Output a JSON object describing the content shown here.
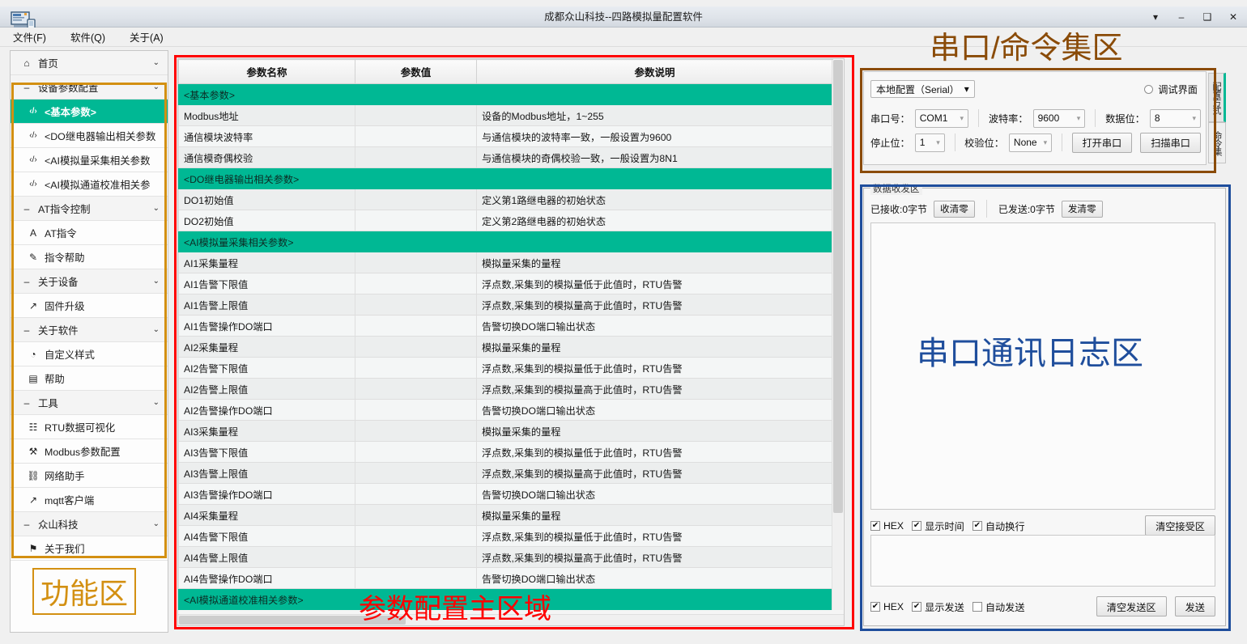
{
  "window": {
    "title": "成都众山科技--四路模拟量配置软件",
    "controls": [
      "▾",
      "–",
      "❑",
      "✕"
    ],
    "app_icon": "computer-icon"
  },
  "menubar": {
    "items": [
      "文件(F)",
      "软件(Q)",
      "关于(A)"
    ]
  },
  "sidebar": {
    "items": [
      {
        "label": "首页",
        "icon": "home-icon",
        "type": "group",
        "chevron": "⌄",
        "active": false
      },
      {
        "label": "设备参数配置",
        "icon": "minus-icon",
        "type": "group",
        "chevron": "⌄",
        "active": false
      },
      {
        "label": "<基本参数>",
        "icon": "code-icon",
        "type": "child",
        "active": true
      },
      {
        "label": "<DO继电器输出相关参数",
        "icon": "code-icon",
        "type": "child",
        "active": false
      },
      {
        "label": "<AI模拟量采集相关参数",
        "icon": "code-icon",
        "type": "child",
        "active": false
      },
      {
        "label": "<AI模拟通道校准相关参",
        "icon": "code-icon",
        "type": "child",
        "active": false
      },
      {
        "label": "AT指令控制",
        "icon": "minus-icon",
        "type": "group",
        "chevron": "⌄",
        "active": false
      },
      {
        "label": "AT指令",
        "icon": "letter-a-icon",
        "type": "child",
        "active": false
      },
      {
        "label": "指令帮助",
        "icon": "pen-icon",
        "type": "child",
        "active": false
      },
      {
        "label": "关于设备",
        "icon": "minus-icon",
        "type": "group",
        "chevron": "⌄",
        "active": false
      },
      {
        "label": "固件升级",
        "icon": "external-link-icon",
        "type": "child",
        "active": false
      },
      {
        "label": "关于软件",
        "icon": "minus-icon",
        "type": "group",
        "chevron": "⌄",
        "active": false
      },
      {
        "label": "自定义样式",
        "icon": "palette-icon",
        "type": "child",
        "active": false
      },
      {
        "label": "帮助",
        "icon": "book-icon",
        "type": "child",
        "active": false
      },
      {
        "label": "工具",
        "icon": "minus-icon",
        "type": "group",
        "chevron": "⌄",
        "active": false
      },
      {
        "label": "RTU数据可视化",
        "icon": "grid-icon",
        "type": "child",
        "active": false
      },
      {
        "label": "Modbus参数配置",
        "icon": "wrench-icon",
        "type": "child",
        "active": false
      },
      {
        "label": "网络助手",
        "icon": "network-icon",
        "type": "child",
        "active": false
      },
      {
        "label": "mqtt客户端",
        "icon": "external-link-icon",
        "type": "child",
        "active": false
      },
      {
        "label": "众山科技",
        "icon": "minus-icon",
        "type": "group",
        "chevron": "⌄",
        "active": false
      },
      {
        "label": "关于我们",
        "icon": "flag-icon",
        "type": "child",
        "active": false
      }
    ]
  },
  "table": {
    "headers": [
      "参数名称",
      "参数值",
      "参数说明"
    ],
    "rows": [
      {
        "section": true,
        "name": "<基本参数>",
        "value": "",
        "desc": ""
      },
      {
        "section": false,
        "name": "Modbus地址",
        "value": "",
        "desc": "设备的Modbus地址，1~255"
      },
      {
        "section": false,
        "name": "通信模块波特率",
        "value": "",
        "desc": "与通信模块的波特率一致，一般设置为9600"
      },
      {
        "section": false,
        "name": "通信模奇偶校验",
        "value": "",
        "desc": "与通信模块的奇偶校验一致，一般设置为8N1"
      },
      {
        "section": true,
        "name": "<DO继电器输出相关参数>",
        "value": "",
        "desc": ""
      },
      {
        "section": false,
        "name": "DO1初始值",
        "value": "",
        "desc": "定义第1路继电器的初始状态"
      },
      {
        "section": false,
        "name": "DO2初始值",
        "value": "",
        "desc": "定义第2路继电器的初始状态"
      },
      {
        "section": true,
        "name": "<AI模拟量采集相关参数>",
        "value": "",
        "desc": ""
      },
      {
        "section": false,
        "name": "AI1采集量程",
        "value": "",
        "desc": "模拟量采集的量程"
      },
      {
        "section": false,
        "name": "AI1告警下限值",
        "value": "",
        "desc": "浮点数,采集到的模拟量低于此值时，RTU告警"
      },
      {
        "section": false,
        "name": "AI1告警上限值",
        "value": "",
        "desc": "浮点数,采集到的模拟量高于此值时，RTU告警"
      },
      {
        "section": false,
        "name": "AI1告警操作DO端口",
        "value": "",
        "desc": "告警切换DO端口输出状态"
      },
      {
        "section": false,
        "name": "AI2采集量程",
        "value": "",
        "desc": "模拟量采集的量程"
      },
      {
        "section": false,
        "name": "AI2告警下限值",
        "value": "",
        "desc": "浮点数,采集到的模拟量低于此值时，RTU告警"
      },
      {
        "section": false,
        "name": "AI2告警上限值",
        "value": "",
        "desc": "浮点数,采集到的模拟量高于此值时，RTU告警"
      },
      {
        "section": false,
        "name": "AI2告警操作DO端口",
        "value": "",
        "desc": "告警切换DO端口输出状态"
      },
      {
        "section": false,
        "name": "AI3采集量程",
        "value": "",
        "desc": "模拟量采集的量程"
      },
      {
        "section": false,
        "name": "AI3告警下限值",
        "value": "",
        "desc": "浮点数,采集到的模拟量低于此值时，RTU告警"
      },
      {
        "section": false,
        "name": "AI3告警上限值",
        "value": "",
        "desc": "浮点数,采集到的模拟量高于此值时，RTU告警"
      },
      {
        "section": false,
        "name": "AI3告警操作DO端口",
        "value": "",
        "desc": "告警切换DO端口输出状态"
      },
      {
        "section": false,
        "name": "AI4采集量程",
        "value": "",
        "desc": "模拟量采集的量程"
      },
      {
        "section": false,
        "name": "AI4告警下限值",
        "value": "",
        "desc": "浮点数,采集到的模拟量低于此值时，RTU告警"
      },
      {
        "section": false,
        "name": "AI4告警上限值",
        "value": "",
        "desc": "浮点数,采集到的模拟量高于此值时，RTU告警"
      },
      {
        "section": false,
        "name": "AI4告警操作DO端口",
        "value": "",
        "desc": "告警切换DO端口输出状态"
      },
      {
        "section": true,
        "name": "<AI模拟通道校准相关参数>",
        "value": "",
        "desc": ""
      }
    ]
  },
  "serial": {
    "mode": "本地配置（Serial）",
    "mode_caret": "▾",
    "debug_label": "调试界面",
    "fields": {
      "port_label": "串口号：",
      "port_value": "COM1",
      "baud_label": "波特率：",
      "baud_value": "9600",
      "data_label": "数据位：",
      "data_value": "8",
      "stop_label": "停止位：",
      "stop_value": "1",
      "parity_label": "校验位：",
      "parity_value": "None"
    },
    "open_button": "打开串口",
    "scan_button": "扫描串口",
    "vtabs": [
      {
        "label": "配置方式",
        "active": true
      },
      {
        "label": "命令集",
        "active": false
      }
    ]
  },
  "data_area": {
    "group_title": "数据收发区",
    "received_label": "已接收:0字节",
    "clear_recv_counter": "收清零",
    "sent_label": "已发送:0字节",
    "clear_send_counter": "发清零",
    "log_text": "",
    "send_text": "",
    "recv_options": [
      {
        "label": "HEX",
        "checked": true
      },
      {
        "label": "显示时间",
        "checked": true
      },
      {
        "label": "自动换行",
        "checked": true
      }
    ],
    "clear_recv_button": "清空接受区",
    "send_options": [
      {
        "label": "HEX",
        "checked": true
      },
      {
        "label": "显示发送",
        "checked": true
      },
      {
        "label": "自动发送",
        "checked": false
      }
    ],
    "clear_send_button": "清空发送区",
    "send_button": "发送"
  },
  "annotations": {
    "function_area": "功能区",
    "main_area": "参数配置主区域",
    "serial_cmd_area": "串口/命令集区",
    "log_area": "串口通讯日志区"
  },
  "colors": {
    "accent_teal": "#00b894",
    "anno_red": "#ff0000",
    "anno_gold": "#d39012",
    "anno_blue": "#1f4e9c",
    "anno_brown": "#8a4b08"
  }
}
